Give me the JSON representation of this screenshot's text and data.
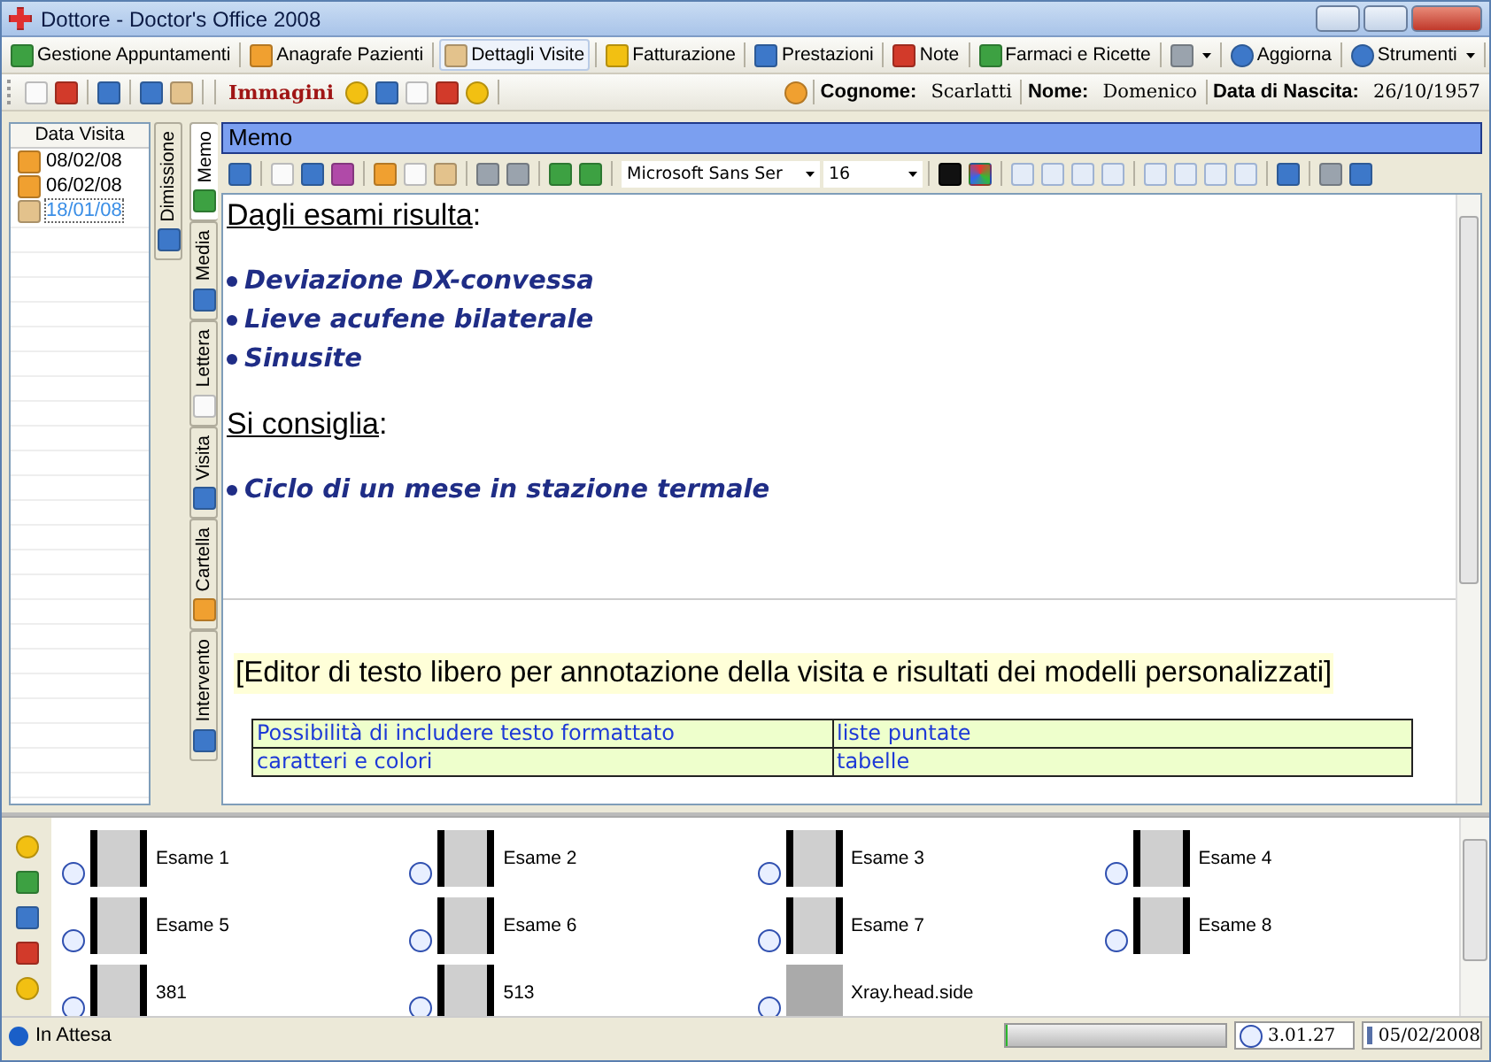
{
  "window": {
    "title": "Dottore - Doctor's Office 2008"
  },
  "menu": [
    {
      "label": "Gestione Appuntamenti",
      "selected": false
    },
    {
      "label": "Anagrafe Pazienti",
      "selected": false
    },
    {
      "label": "Dettagli Visite",
      "selected": true
    },
    {
      "label": "Fatturazione",
      "selected": false
    },
    {
      "label": "Prestazioni",
      "selected": false
    },
    {
      "label": "Note",
      "selected": false
    },
    {
      "label": "Farmaci e Ricette",
      "selected": false
    }
  ],
  "menu_right": [
    {
      "label": "Aggiorna",
      "dropdown": false
    },
    {
      "label": "Strumenti",
      "dropdown": true
    }
  ],
  "toolbar": {
    "images_label": "Immagini",
    "patient": [
      {
        "label": "Cognome:",
        "value": "Scarlatti"
      },
      {
        "label": "Nome:",
        "value": "Domenico"
      },
      {
        "label": "Data di Nascita:",
        "value": "26/10/1957"
      }
    ]
  },
  "visits": {
    "column": "Data Visita",
    "items": [
      {
        "date": "08/02/08",
        "selected": false
      },
      {
        "date": "06/02/08",
        "selected": false
      },
      {
        "date": "18/01/08",
        "selected": true
      }
    ]
  },
  "side_tabs_back": [
    {
      "label": "Dimissione",
      "selected": false
    }
  ],
  "side_tabs": [
    {
      "label": "Memo",
      "selected": true
    },
    {
      "label": "Media",
      "selected": false
    },
    {
      "label": "Lettera",
      "selected": false
    },
    {
      "label": "Visita",
      "selected": false
    },
    {
      "label": "Cartella",
      "selected": false
    },
    {
      "label": "Intervento",
      "selected": false
    }
  ],
  "editor": {
    "title": "Memo",
    "font": "Microsoft Sans Ser",
    "size": "16",
    "content": [
      {
        "kind": "heading",
        "text": "Dagli esami risulta",
        "suffix": ":"
      },
      {
        "kind": "bullet",
        "text": "Deviazione DX-convessa"
      },
      {
        "kind": "bullet",
        "text": "Lieve acufene bilaterale"
      },
      {
        "kind": "bullet",
        "text": "Sinusite"
      },
      {
        "kind": "heading",
        "text": "Si consiglia",
        "suffix": ":"
      },
      {
        "kind": "bullet",
        "text": "Ciclo di un mese in stazione termale"
      }
    ],
    "note": "[Editor di testo libero per annotazione della visita e risultati dei modelli personalizzati]",
    "table": [
      [
        "Possibilità di includere testo formattato",
        "liste puntate"
      ],
      [
        "caratteri e colori",
        "tabelle"
      ]
    ]
  },
  "gallery": [
    {
      "label": "Esame 1"
    },
    {
      "label": "Esame 2"
    },
    {
      "label": "Esame 3"
    },
    {
      "label": "Esame 4"
    },
    {
      "label": "Esame 5"
    },
    {
      "label": "Esame 6"
    },
    {
      "label": "Esame 7"
    },
    {
      "label": "Esame 8"
    },
    {
      "label": "381"
    },
    {
      "label": "513"
    },
    {
      "label": "Xray.head.side"
    }
  ],
  "status_bar": {
    "text": "In Attesa",
    "progress": {
      "level": 0.01
    },
    "time": "3.01.27",
    "date": "05/02/2008"
  }
}
